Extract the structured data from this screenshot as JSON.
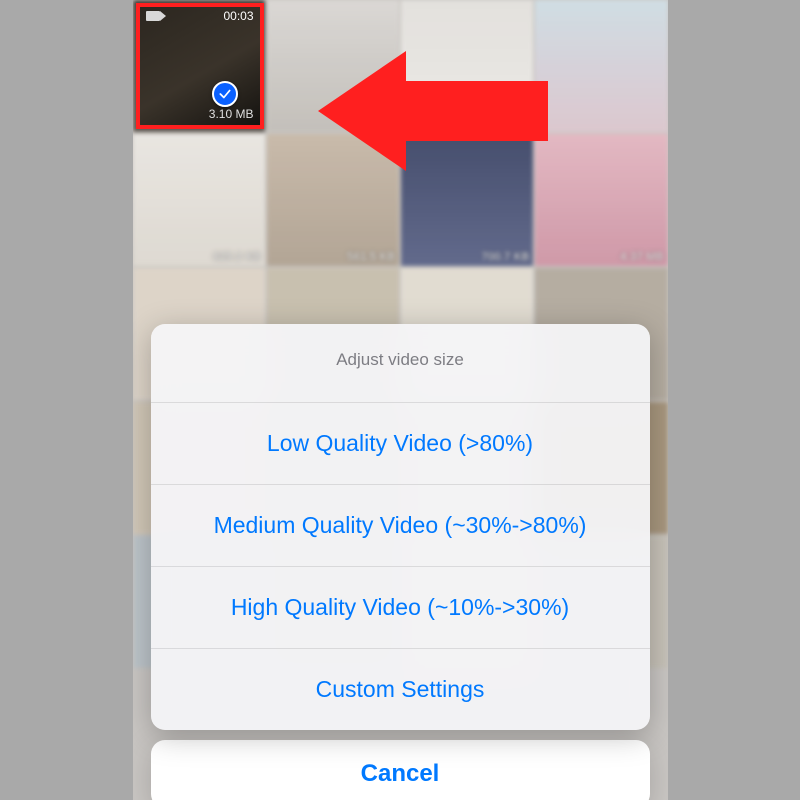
{
  "selected_video": {
    "duration": "00:03",
    "filesize": "3.10 MB"
  },
  "background_sizes": {
    "row2_1": "625.2 KB",
    "row2_2": "561.5 KB",
    "row2_3": "700.7 KB",
    "row2_4": "4.37 MB"
  },
  "sheet": {
    "title": "Adjust video size",
    "options": {
      "low": "Low Quality Video (>80%)",
      "medium": "Medium Quality Video (~30%->80%)",
      "high": "High Quality Video (~10%->30%)",
      "custom": "Custom Settings"
    },
    "cancel": "Cancel"
  },
  "arrow_color": "#ff1f1f"
}
